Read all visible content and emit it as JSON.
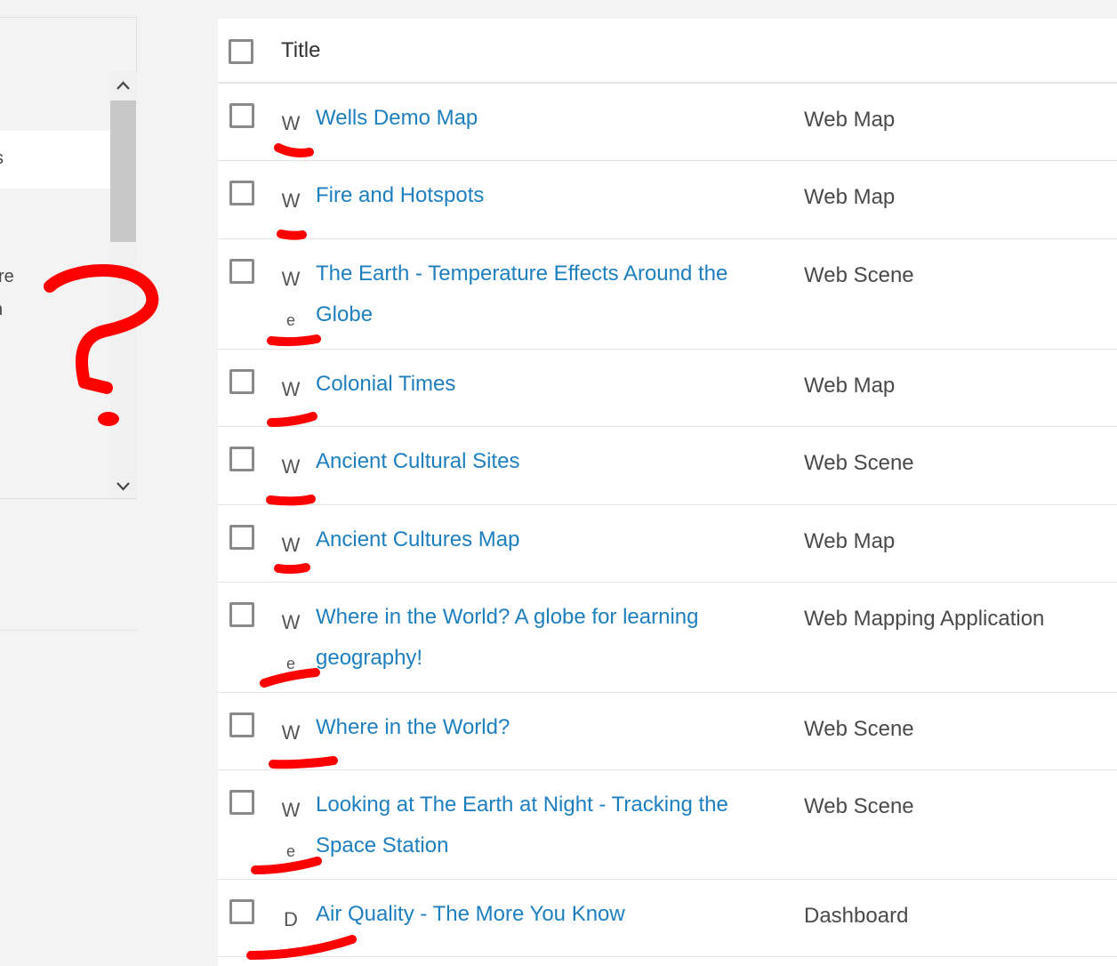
{
  "sidebar": {
    "fragment_1": "s",
    "fragment_2": "re",
    "fragment_3": "n"
  },
  "table": {
    "header": {
      "title": "Title"
    },
    "rows": [
      {
        "type_icon": "W",
        "type_icon_2": "",
        "title_line1": "Wells Demo Map",
        "title_line2": "",
        "type": "Web Map"
      },
      {
        "type_icon": "W",
        "type_icon_2": "",
        "title_line1": "Fire and Hotspots",
        "title_line2": "",
        "type": "Web Map"
      },
      {
        "type_icon": "W",
        "type_icon_2": "e",
        "title_line1": "The Earth - Temperature Effects Around the",
        "title_line2": "Globe",
        "type": "Web Scene"
      },
      {
        "type_icon": "W",
        "type_icon_2": "",
        "title_line1": "Colonial Times",
        "title_line2": "",
        "type": "Web Map"
      },
      {
        "type_icon": "W",
        "type_icon_2": "",
        "title_line1": "Ancient Cultural Sites",
        "title_line2": "",
        "type": "Web Scene"
      },
      {
        "type_icon": "W",
        "type_icon_2": "",
        "title_line1": "Ancient Cultures Map",
        "title_line2": "",
        "type": "Web Map"
      },
      {
        "type_icon": "W",
        "type_icon_2": "e",
        "title_line1": "Where in the World? A globe for learning",
        "title_line2": "geography!",
        "type": "Web Mapping Application"
      },
      {
        "type_icon": "W",
        "type_icon_2": "",
        "title_line1": "Where in the World?",
        "title_line2": "",
        "type": "Web Scene"
      },
      {
        "type_icon": "W",
        "type_icon_2": "e",
        "title_line1": "Looking at The Earth at Night - Tracking the",
        "title_line2": "Space Station",
        "type": "Web Scene"
      },
      {
        "type_icon": "D",
        "type_icon_2": "",
        "title_line1": "Air Quality - The More You Know",
        "title_line2": "",
        "type": "Dashboard"
      }
    ]
  },
  "colors": {
    "link": "#1e7fbf",
    "annotation": "#ff0000"
  }
}
